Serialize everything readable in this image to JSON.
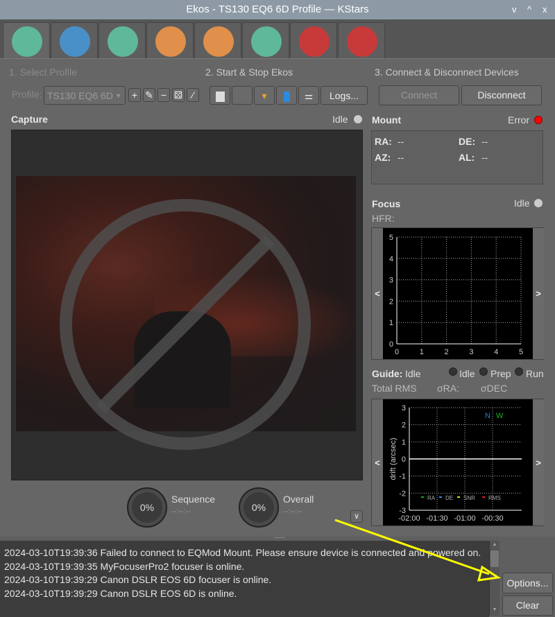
{
  "window": {
    "title": "Ekos - TS130 EQ6 6D Profile — KStars",
    "controls": [
      "v",
      "^",
      "x"
    ]
  },
  "tabs": [
    {
      "name": "setup",
      "icon": "wrench-screwdriver-icon",
      "color": "#5fb89a"
    },
    {
      "name": "scheduler",
      "icon": "notebook-icon",
      "color": "#4a90c8"
    },
    {
      "name": "analyze",
      "icon": "graph-icon",
      "color": "#5fb89a"
    },
    {
      "name": "capture",
      "icon": "camera-icon",
      "color": "#e0904a"
    },
    {
      "name": "focus",
      "icon": "magnifier-icon",
      "color": "#e0904a"
    },
    {
      "name": "mount",
      "icon": "tripod-icon",
      "color": "#5fb89a"
    },
    {
      "name": "align",
      "icon": "target-icon",
      "color": "#c83a3a"
    },
    {
      "name": "guide",
      "icon": "compass-icon",
      "color": "#c83a3a"
    }
  ],
  "steps": {
    "profile": "1. Select Profile",
    "startstop": "2. Start & Stop Ekos",
    "connect": "3. Connect & Disconnect Devices"
  },
  "profile": {
    "label": "Profile:",
    "value": "TS130 EQ6 6D"
  },
  "buttons": {
    "logs": "Logs...",
    "connect": "Connect",
    "disconnect": "Disconnect",
    "options": "Options...",
    "clear": "Clear"
  },
  "capture": {
    "title": "Capture",
    "status": "Idle",
    "sequence_label": "Sequence",
    "sequence_pct": "0%",
    "sequence_time": "--:--:--",
    "overall_label": "Overall",
    "overall_pct": "0%",
    "overall_time": "--:--:--"
  },
  "mount": {
    "title": "Mount",
    "status": "Error",
    "status_color": "#ff0000",
    "ra_label": "RA:",
    "ra": "--",
    "de_label": "DE:",
    "de": "--",
    "az_label": "AZ:",
    "az": "--",
    "al_label": "AL:",
    "al": "--"
  },
  "focus": {
    "title": "Focus",
    "status": "Idle",
    "hfr_label": "HFR:"
  },
  "guide": {
    "title": "Guide:",
    "status": "Idle",
    "states": [
      "Idle",
      "Prep",
      "Run"
    ],
    "rms_label": "Total RMS",
    "sra_label": "σRA:",
    "sdec_label": "σDEC"
  },
  "chart_data": [
    {
      "type": "line",
      "xlim": [
        0,
        5
      ],
      "ylim": [
        0,
        5
      ],
      "xticks": [
        "0",
        "1",
        "2",
        "3",
        "4",
        "5"
      ],
      "yticks": [
        "0",
        "1",
        "2",
        "3",
        "4",
        "5"
      ],
      "grid": true,
      "series": []
    },
    {
      "type": "line",
      "ylabel": "drift (arcsec)",
      "ylim": [
        -3,
        3
      ],
      "yticks": [
        "3",
        "2",
        "1",
        "0",
        "-1",
        "-2",
        "-3"
      ],
      "xticks": [
        "-02:00",
        "-01:30",
        "-01:00",
        "-00:30"
      ],
      "grid": true,
      "compass": {
        "n": "N",
        "w": "W"
      },
      "legend": [
        {
          "name": "RA",
          "color": "#00c000"
        },
        {
          "name": "DE",
          "color": "#1e90ff"
        },
        {
          "name": "SNR",
          "color": "#e0e000"
        },
        {
          "name": "RMS",
          "color": "#e02020"
        }
      ],
      "legend_position": "bottom",
      "series": []
    }
  ],
  "log": [
    "2024-03-10T19:39:36 Failed to connect to EQMod Mount. Please ensure device is connected and powered on.",
    "2024-03-10T19:39:35 MyFocuserPro2 focuser is online.",
    "2024-03-10T19:39:29 Canon DSLR EOS 6D focuser is online.",
    "2024-03-10T19:39:29 Canon DSLR EOS 6D is online."
  ],
  "annotation": {
    "arrow_color": "#ffff00"
  }
}
